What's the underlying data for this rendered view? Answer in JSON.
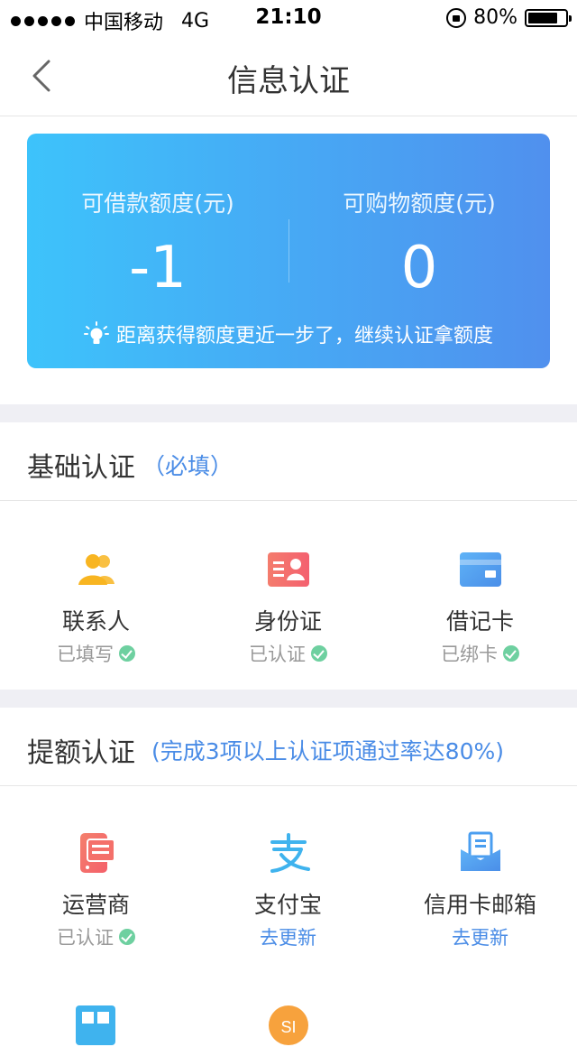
{
  "status_bar": {
    "carrier": "中国移动",
    "network": "4G",
    "time": "21:10",
    "battery": "80%",
    "battery_level": 0.8
  },
  "nav": {
    "title": "信息认证",
    "back_icon": "chevron-left-icon"
  },
  "quota_card": {
    "loan_label": "可借款额度(元)",
    "loan_value": "-1",
    "shop_label": "可购物额度(元)",
    "shop_value": "0",
    "hint": "距离获得额度更近一步了，继续认证拿额度",
    "hint_icon": "lightbulb-icon",
    "gradient_start": "#3dc3fb",
    "gradient_end": "#5090ee"
  },
  "basic_section": {
    "title": "基础认证",
    "note": "（必填）",
    "items": [
      {
        "label": "联系人",
        "status": "已填写",
        "icon": "contacts-icon",
        "color": "#f8b521"
      },
      {
        "label": "身份证",
        "status": "已认证",
        "icon": "id-card-icon",
        "color": "#f4706a"
      },
      {
        "label": "借记卡",
        "status": "已绑卡",
        "icon": "bank-card-icon",
        "color": "#4a9ef0"
      }
    ]
  },
  "boost_section": {
    "title": "提额认证",
    "note": "(完成3项以上认证项通过率达80%)",
    "items": [
      {
        "label": "运营商",
        "status": "已认证",
        "icon": "phone-carrier-icon",
        "color": "#f4706a"
      },
      {
        "label": "支付宝",
        "status": "去更新",
        "icon": "alipay-icon",
        "color": "#3fb3ee"
      },
      {
        "label": "信用卡邮箱",
        "status": "去更新",
        "icon": "email-icon",
        "color": "#4a9ef0"
      }
    ]
  },
  "colors": {
    "accent_blue": "#4a8ce6",
    "check_green": "#6ed0a0",
    "separator": "#efeff4"
  }
}
